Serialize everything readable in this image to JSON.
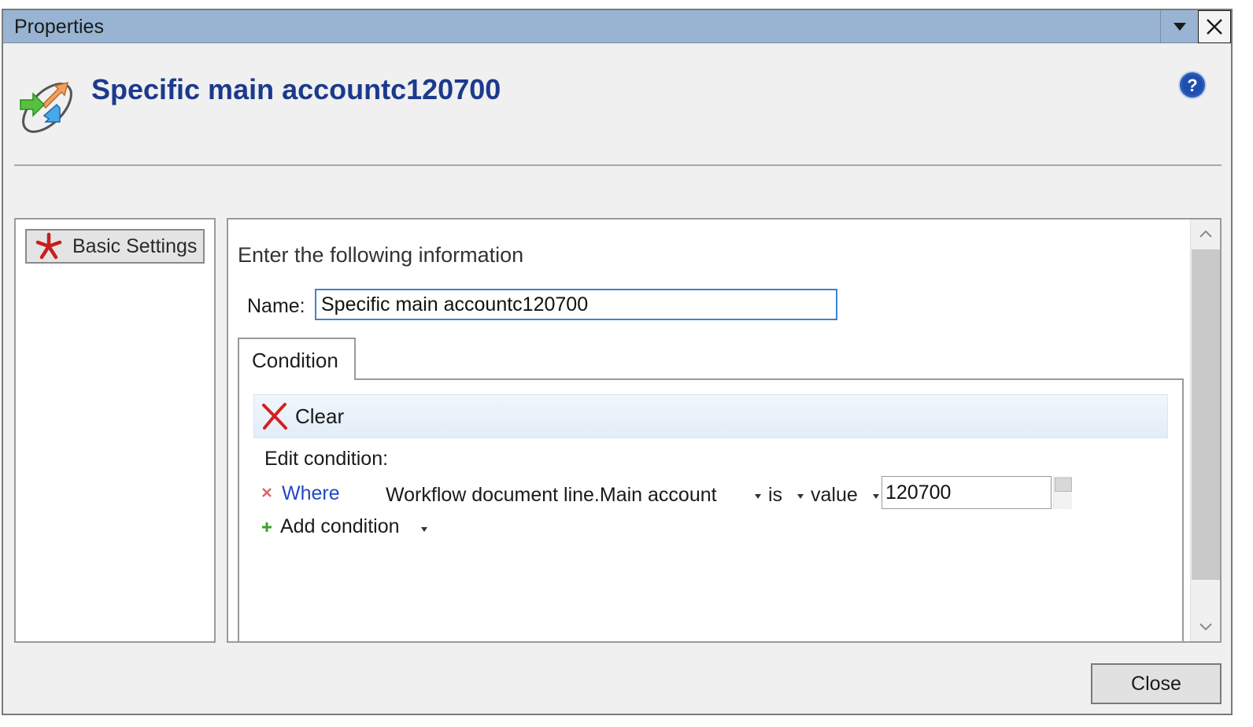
{
  "window": {
    "title": "Properties"
  },
  "header": {
    "title": "Specific main accountc120700",
    "icon": "workflow-conditional-decision-icon",
    "help_icon": "help-icon"
  },
  "nav": {
    "items": [
      {
        "label": "Basic Settings",
        "icon": "required-asterisk-icon",
        "selected": true
      }
    ]
  },
  "form": {
    "heading": "Enter the following information",
    "name_label": "Name:",
    "name_value": "Specific main accountc120700"
  },
  "tabs": [
    {
      "label": "Condition",
      "active": true
    }
  ],
  "condition": {
    "clear_label": "Clear",
    "edit_label": "Edit condition:",
    "row": {
      "connector": "Where",
      "field": "Workflow document line.Main account",
      "operator": "is",
      "value_type": "value",
      "value": "120700"
    },
    "add_label": "Add condition"
  },
  "footer": {
    "close_label": "Close"
  },
  "colors": {
    "titlebar": "#98b4d2",
    "header_title": "#1b3a8c",
    "link": "#2048c8",
    "input_focus_border": "#3c83d1",
    "clear_icon": "#d42020",
    "add_icon": "#3aa52a"
  }
}
